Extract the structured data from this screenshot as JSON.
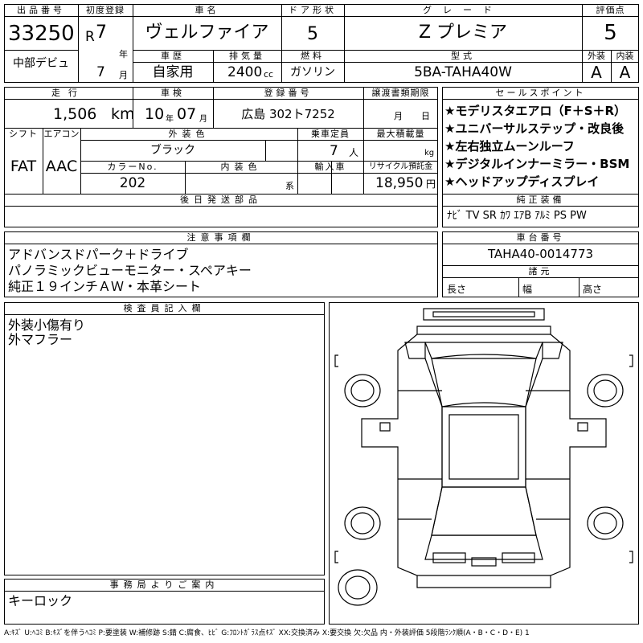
{
  "header": {
    "lot_no_label": "出品番号",
    "lot_no": "33250",
    "debut": "中部デビュ",
    "first_reg_label": "初度登録",
    "era": "R",
    "reg_year": "7",
    "year_unit": "年",
    "reg_month": "7",
    "month_unit": "月",
    "car_name_label": "車名",
    "car_name": "ヴェルファイア",
    "door_label": "ドア形状",
    "doors": "5",
    "grade_label": "グレード",
    "grade": "Z プレミア",
    "score_label": "評価点",
    "score": "5",
    "history_label": "車歴",
    "history": "自家用",
    "displacement_label": "排気量",
    "displacement": "2400",
    "displacement_unit": "cc",
    "fuel_label": "燃料",
    "fuel": "ガソリン",
    "model_label": "型式",
    "model": "5BA-TAHA40W",
    "exterior_label": "外装",
    "exterior_grade": "A",
    "interior_label": "内装",
    "interior_grade": "A"
  },
  "specs": {
    "mileage_label": "走行",
    "mileage": "1,506",
    "mileage_unit": "km",
    "inspection_label": "車検",
    "inspection_year": "10",
    "inspection_year_unit": "年",
    "inspection_month": "07",
    "inspection_month_unit": "月",
    "plate_label": "登録番号",
    "plate": "広島 302ト7252",
    "transfer_label": "譲渡書類期限",
    "transfer_month_unit": "月",
    "transfer_day_unit": "日",
    "shift_label": "シフト",
    "shift": "FAT",
    "ac_label": "エアコン",
    "ac": "AAC",
    "ext_color_label": "外装色",
    "ext_color": "ブラック",
    "capacity_label": "乗車定員",
    "capacity": "7",
    "capacity_unit": "人",
    "load_label": "最大積載量",
    "load_unit": "kg",
    "color_no_label": "カラーNo.",
    "color_no": "202",
    "int_color_label": "内装色",
    "int_color_unit": "系",
    "import_label": "輸入車",
    "recycle_label": "リサイクル預託金",
    "recycle": "18,950",
    "recycle_unit": "円",
    "later_parts_label": "後日発送部品"
  },
  "sales_points": {
    "label": "セールスポイント",
    "items": [
      "★モデリスタエアロ（F＋S＋R）",
      "★ユニバーサルステップ・改良後",
      "★左右独立ムーンルーフ",
      "★デジタルインナーミラー・BSM",
      "★ヘッドアップディスプレイ"
    ]
  },
  "equipment": {
    "label": "純正装備",
    "items": [
      "ﾅﾋﾞ",
      "TV",
      "SR",
      "ｶﾜ",
      "ｴｱB",
      "ｱﾙﾐ",
      "PS",
      "PW"
    ]
  },
  "notes": {
    "label": "注意事項欄",
    "lines": [
      "アドバンスドパーク＋ドライブ",
      "パノラミックビューモニター・スペアキー",
      "純正１９インチＡＷ・本革シート"
    ]
  },
  "chassis": {
    "label": "車台番号",
    "value": "TAHA40-0014773",
    "dims_label": "諸元",
    "length_label": "長さ",
    "width_label": "幅",
    "height_label": "高さ"
  },
  "inspector": {
    "label": "検査員記入欄",
    "lines": [
      "外装小傷有り",
      "外マフラー"
    ]
  },
  "office": {
    "label": "事務局よりご案内",
    "lines": [
      "キーロック"
    ]
  },
  "legend": "A:ｷｽﾞ U:ﾍｺﾐ B:ｷｽﾞを伴うﾍｺﾐ P:要塗装 W:補修跡 S:錆 C:腐食、ﾋﾋﾞ G:ﾌﾛﾝﾄｶﾞﾗｽ点ｷｽﾞ XX:交換済み X:要交換 欠:欠品 内・外装評価 5段階ﾗﾝｸ順(A・B・C・D・E) 1"
}
